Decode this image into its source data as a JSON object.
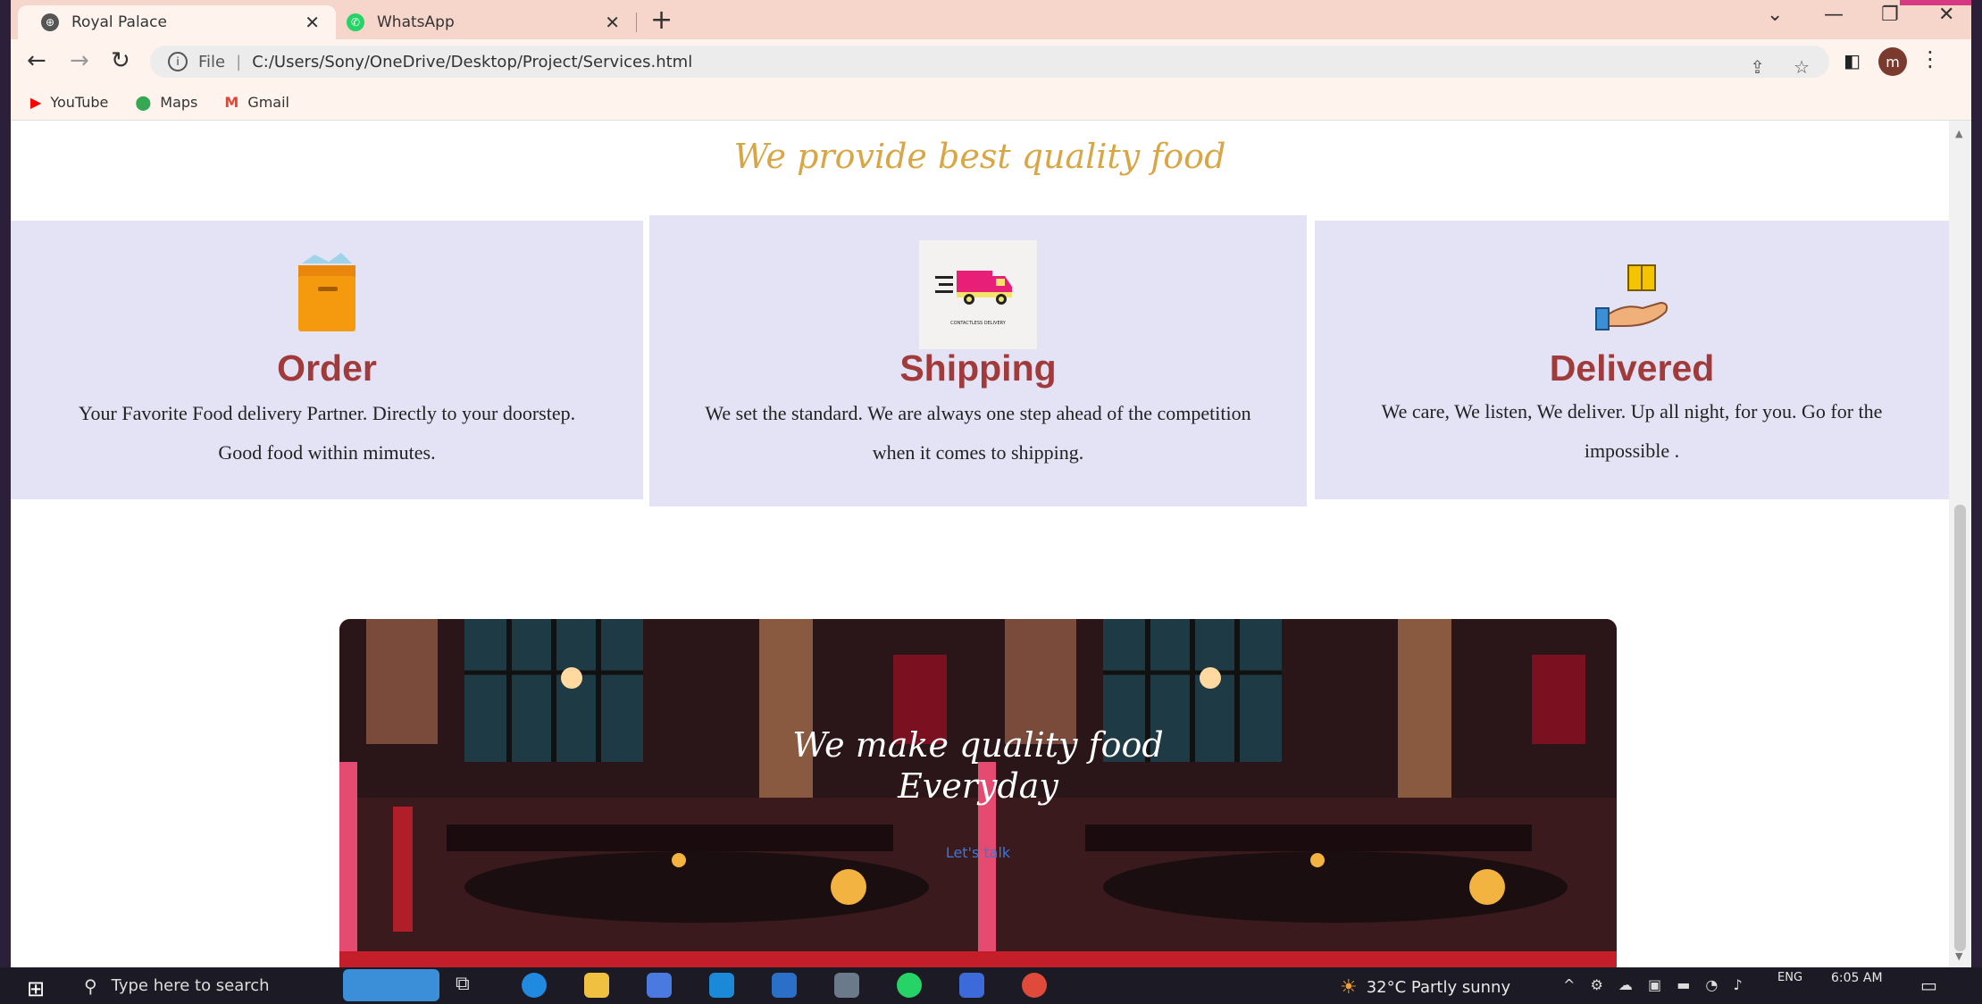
{
  "browser": {
    "tabs": [
      {
        "label": "Royal Palace",
        "icon": "globe-icon",
        "active": true
      },
      {
        "label": "WhatsApp",
        "icon": "whatsapp-icon",
        "active": false
      }
    ],
    "address": {
      "prefix": "File",
      "url": "C:/Users/Sony/OneDrive/Desktop/Project/Services.html"
    },
    "avatar_letter": "m",
    "bookmarks": [
      {
        "label": "YouTube",
        "icon": "youtube-icon",
        "color": "#ff0000"
      },
      {
        "label": "Maps",
        "icon": "maps-pin-icon",
        "color": "#34a853"
      },
      {
        "label": "Gmail",
        "icon": "gmail-icon",
        "color": "#ea4335"
      }
    ]
  },
  "page": {
    "headline": "We provide best quality food",
    "cards": [
      {
        "title": "Order",
        "text": "Your Favorite Food delivery Partner. Directly to your doorstep. Good food within mimutes.",
        "icon": "food-box-icon"
      },
      {
        "title": "Shipping",
        "text": "We set the standard. We are always one step ahead of the competition when it comes to shipping.",
        "icon": "delivery-truck-icon",
        "icon_caption": "CONTACTLESS DELIVERY"
      },
      {
        "title": "Delivered",
        "text": "We care, We listen, We deliver. Up all night, for you. Go for the impossible .",
        "icon": "hand-package-icon"
      }
    ],
    "banner": {
      "line1": "We make quality food",
      "line2": "Everyday",
      "button": "Let's talk"
    }
  },
  "taskbar": {
    "search_placeholder": "Type here to search",
    "weather": "32°C  Partly sunny",
    "lang": "ENG",
    "time": "6:05 AM"
  },
  "colors": {
    "tab_strip": "#f6d6cb",
    "card_bg": "#e4e3f6",
    "card_title": "#a13a3a",
    "headline": "#d9a646"
  }
}
